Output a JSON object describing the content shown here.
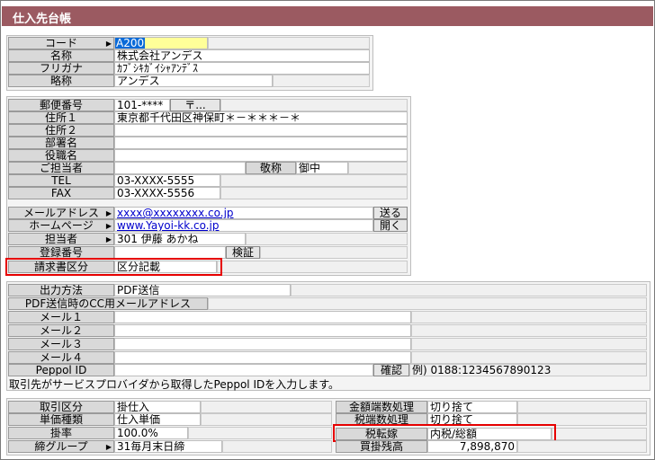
{
  "window": {
    "title": "仕入先台帳"
  },
  "basic": {
    "code_label": "コード",
    "code_value": "A200",
    "name_label": "名称",
    "name_value": "株式会社アンデス",
    "kana_label": "フリガナ",
    "kana_value": "ｶﾌﾞｼｷｶﾞｲｼｬｱﾝﾃﾞｽ",
    "short_label": "略称",
    "short_value": "アンデス"
  },
  "address": {
    "postal_label": "郵便番号",
    "postal_value": "101-****",
    "postal_button": "〒...",
    "addr1_label": "住所１",
    "addr1_value": "東京都千代田区神保町＊－＊＊＊－＊",
    "addr2_label": "住所２",
    "dept_label": "部署名",
    "title_label": "役職名",
    "contact_label": "ご担当者",
    "honorific_label": "敬称",
    "honorific_value": "御中",
    "tel_label": "TEL",
    "tel_value": "03-XXXX-5555",
    "fax_label": "FAX",
    "fax_value": "03-XXXX-5556",
    "mail_label": "メールアドレス",
    "mail_value": "xxxx@xxxxxxxx.co.jp",
    "send_button": "送る",
    "home_label": "ホームページ",
    "home_value": "www.Yayoi-kk.co.jp",
    "open_button": "開く",
    "staff_label": "担当者",
    "staff_code": "301",
    "staff_name": "伊藤 あかね",
    "reg_label": "登録番号",
    "verify_button": "検証",
    "invoice_label": "請求書区分",
    "invoice_value": "区分記載"
  },
  "output": {
    "method_label": "出力方法",
    "method_value": "PDF送信",
    "cc_label": "PDF送信時のCC用メールアドレス",
    "mail1": "メール１",
    "mail2": "メール２",
    "mail3": "メール３",
    "mail4": "メール４",
    "peppol_label": "Peppol ID",
    "confirm_button": "確認",
    "peppol_example": "例) 0188:1234567890123",
    "peppol_note": "取引先がサービスプロバイダから取得したPeppol IDを入力します。"
  },
  "trade": {
    "type_label": "取引区分",
    "type_value": "掛仕入",
    "price_label": "単価種類",
    "price_value": "仕入単価",
    "rate_label": "掛率",
    "rate_value": "100.0",
    "rate_unit": "%",
    "group_label": "締グループ",
    "group_code": "31",
    "group_value": "毎月末日締",
    "round_label": "金額端数処理",
    "round_value": "切り捨て",
    "tax_round_label": "税端数処理",
    "tax_round_value": "切り捨て",
    "tax_shift_label": "税転嫁",
    "tax_shift_value": "内税/総額",
    "balance_label": "買掛残高",
    "balance_value": "7,898,870"
  },
  "colors": {
    "title_bg": "#9b5a61",
    "highlight_box": "#e60000",
    "selection": "#0a6ad8"
  }
}
